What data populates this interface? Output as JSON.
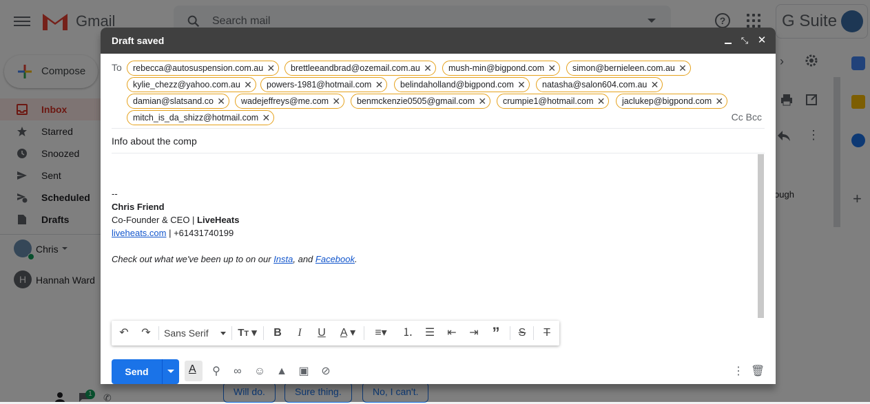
{
  "gmail": {
    "app_name": "Gmail",
    "search_placeholder": "Search mail",
    "gsuite_label": "G Suite",
    "compose_label": "Compose",
    "sidebar": [
      {
        "label": "Inbox",
        "icon": "inbox-icon",
        "active": true
      },
      {
        "label": "Starred",
        "icon": "star-icon"
      },
      {
        "label": "Snoozed",
        "icon": "clock-icon"
      },
      {
        "label": "Sent",
        "icon": "send-icon"
      },
      {
        "label": "Scheduled",
        "icon": "scheduled-icon"
      },
      {
        "label": "Drafts",
        "icon": "draft-icon"
      }
    ],
    "users": [
      {
        "name": "Chris"
      },
      {
        "name": "Hannah Ward",
        "initial": "H"
      }
    ],
    "bg_snippet": "ough",
    "smart_replies": [
      "Will do.",
      "Sure thing.",
      "No, I can't."
    ],
    "chat_badge": "1"
  },
  "compose": {
    "title": "Draft saved",
    "to_label": "To",
    "recipients": [
      "rebecca@autosuspension.com.au",
      "brettleeandbrad@ozemail.com.au",
      "mush-min@bigpond.com",
      "simon@bernieleen.com.au",
      "kylie_chezz@yahoo.com.au",
      "powers-1981@hotmail.com",
      "belindaholland@bigpond.com",
      "natasha@salon604.com.au",
      "damian@slatsand.co",
      "wadejeffreys@me.com",
      "benmckenzie0505@gmail.com",
      "crumpie1@hotmail.com",
      "jaclukep@bigpond.com",
      "mitch_is_da_shizz@hotmail.com"
    ],
    "cc_bcc": "Cc Bcc",
    "subject": "Info about the comp",
    "signature": {
      "dash": "--",
      "name": "Chris Friend",
      "role_prefix": "Co-Founder & CEO | ",
      "company": "LiveHeats",
      "website": "liveheats.com",
      "phone_sep": " | +61431740199",
      "italic_prefix": "Check out what we've been up to on our ",
      "link1": "Insta",
      "italic_mid": ", and ",
      "link2": "Facebook",
      "italic_end": "."
    },
    "toolbar": {
      "font": "Sans Serif"
    },
    "send_label": "Send"
  }
}
